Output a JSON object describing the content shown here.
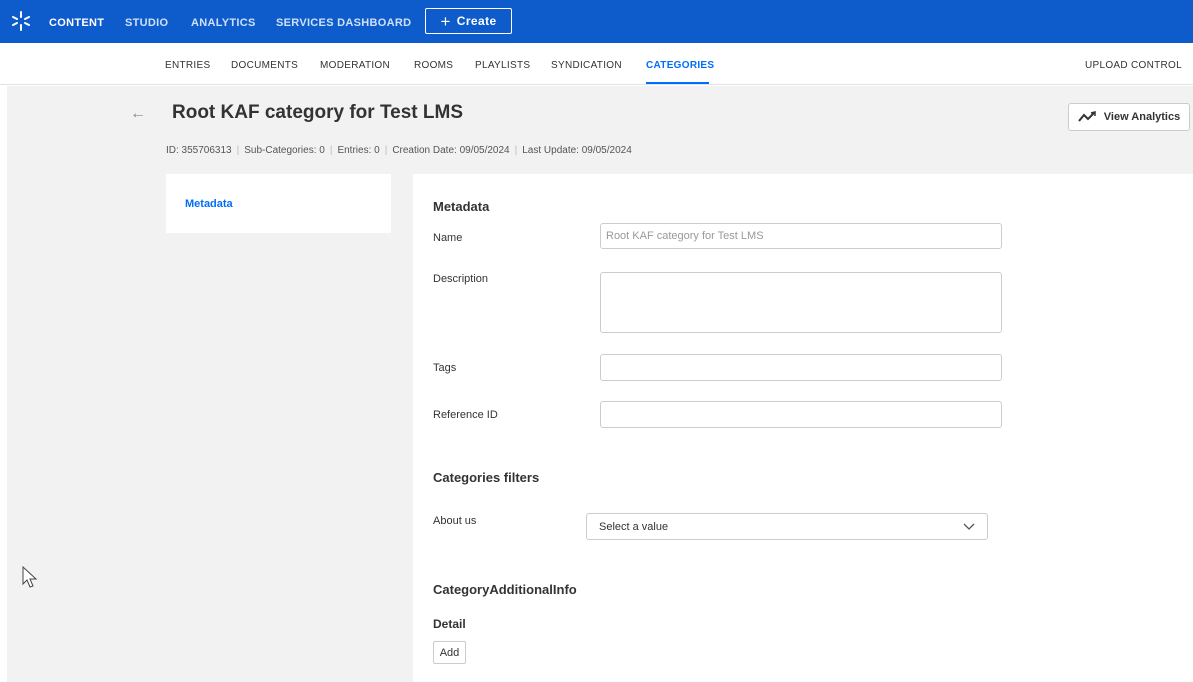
{
  "topnav": {
    "items": [
      "CONTENT",
      "STUDIO",
      "ANALYTICS",
      "SERVICES DASHBOARD"
    ],
    "create_label": "Create"
  },
  "subnav": {
    "items": [
      "ENTRIES",
      "DOCUMENTS",
      "MODERATION",
      "ROOMS",
      "PLAYLISTS",
      "SYNDICATION",
      "CATEGORIES"
    ],
    "right": "UPLOAD CONTROL",
    "active": "CATEGORIES"
  },
  "header": {
    "title": "Root KAF category for Test LMS",
    "analytics_label": "View Analytics",
    "id": "ID: 355706313",
    "subcategories": "Sub-Categories: 0",
    "entries": "Entries: 0",
    "creation": "Creation Date: 09/05/2024",
    "updated": "Last Update: 09/05/2024"
  },
  "sidebar": {
    "items": [
      "Metadata"
    ]
  },
  "form": {
    "metadata_heading": "Metadata",
    "name_label": "Name",
    "name_value": "Root KAF category for Test LMS",
    "description_label": "Description",
    "tags_label": "Tags",
    "reference_label": "Reference ID",
    "filters_heading": "Categories filters",
    "about_label": "About us",
    "about_placeholder": "Select a value",
    "additional_heading": "CategoryAdditionalInfo",
    "detail_label": "Detail",
    "add_label": "Add"
  },
  "colors": {
    "brand": "#0e5ccc",
    "accent": "#006efa",
    "page_bg": "#f2f2f2"
  }
}
